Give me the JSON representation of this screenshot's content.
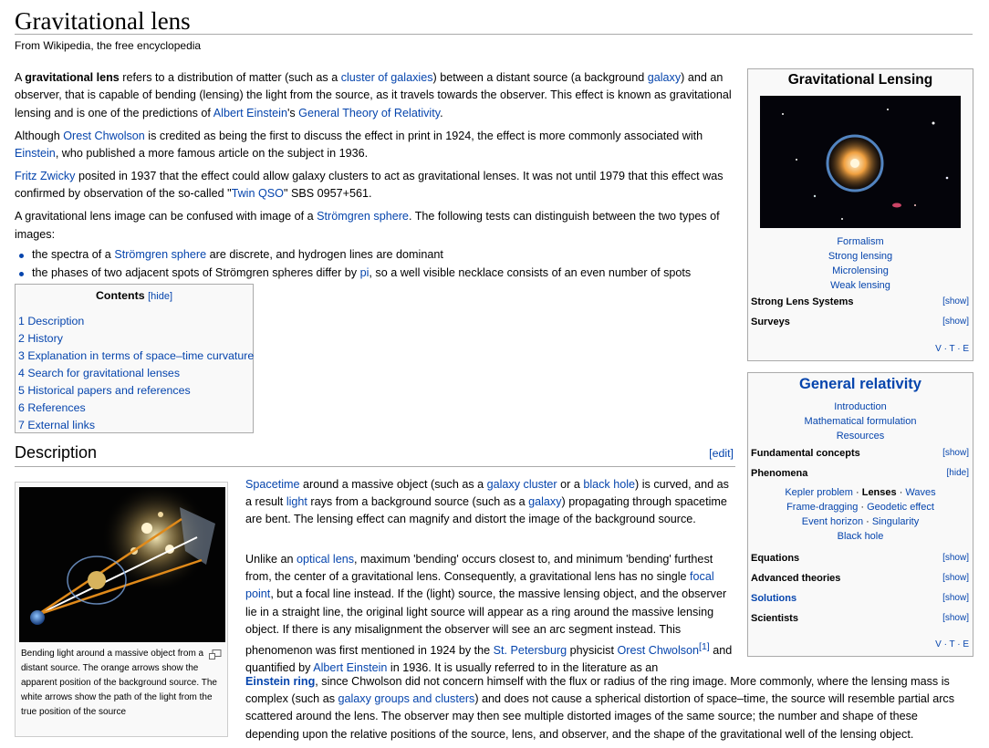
{
  "page": {
    "title": "Gravitational lens",
    "tagline": "From Wikipedia, the free encyclopedia"
  },
  "intro": {
    "p1": {
      "a": "A ",
      "bold": "gravitational lens",
      "b": " refers to a distribution of matter (such as a ",
      "link1": "cluster of galaxies",
      "c": ") between a distant source (a background ",
      "link2": "galaxy",
      "d": ") and an observer, that is capable of bending (lensing) the light from the source, as it travels towards the observer. This effect is known as gravitational lensing and is one of the predictions of ",
      "link3": "Albert Einstein",
      "e": "'s ",
      "link4": "General Theory of Relativity",
      "f": "."
    },
    "p2": {
      "a": "Although ",
      "link1": "Orest Chwolson",
      "b": " is credited as being the first to discuss the effect in print in 1924, the effect is more commonly associated with ",
      "link2": "Einstein",
      "c": ", who published a more famous article on the subject in 1936."
    },
    "p3": {
      "link1": "Fritz Zwicky",
      "a": " posited in 1937 that the effect could allow galaxy clusters to act as gravitational lenses. It was not until 1979 that this effect was confirmed by observation of the so-called \"",
      "link2": "Twin QSO",
      "b": "\" SBS 0957+561."
    },
    "p4": {
      "a": "A gravitational lens image can be confused with image of a ",
      "link1": "Strömgren sphere",
      "b": ". The following tests can distinguish between the two types of images:"
    },
    "bullets": [
      {
        "a": "the spectra of a ",
        "link": "Strömgren sphere",
        "b": " are discrete, and hydrogen lines are dominant"
      },
      {
        "a": "the phases of two adjacent spots of Strömgren spheres differ by ",
        "link": "pi",
        "b": ", so a well visible necklace consists of an even number of spots"
      }
    ]
  },
  "toc": {
    "title": "Contents",
    "hide": "[hide]",
    "items": [
      "1 Description",
      "2 History",
      "3 Explanation in terms of space–time curvature",
      "4 Search for gravitational lenses",
      "5 Historical papers and references",
      "6 References",
      "7 External links"
    ]
  },
  "description": {
    "heading": "Description",
    "edit": "[edit]",
    "thumb_caption": "Bending light around a massive object from a distant source. The orange arrows show the apparent position of the background source. The white arrows show the path of the light from the true position of the source",
    "p1": {
      "link1": "Spacetime",
      "a": " around a massive object (such as a ",
      "link2": "galaxy cluster",
      "b": " or a ",
      "link3": "black hole",
      "c": ") is curved, and as a result ",
      "link4": "light",
      "d": " rays from a background source (such as a ",
      "link5": "galaxy",
      "e": ") propagating through spacetime are bent. The lensing effect can magnify and distort the image of the background source."
    },
    "p2": {
      "a": "Unlike an ",
      "link1": "optical lens",
      "b": ", maximum 'bending' occurs closest to, and minimum 'bending' furthest from, the center of a gravitational lens. Consequently, a gravitational lens has no single ",
      "link2": "focal point",
      "c": ", but a focal line instead. If the (light) source, the massive lensing object, and the observer lie in a straight line, the original light source will appear as a ring around the massive lensing object. If there is any misalignment the observer will see an arc segment instead. This phenomenon was first mentioned in 1924 by the ",
      "link3": "St. Petersburg",
      "d": " physicist ",
      "link4": "Orest Chwolson",
      "sup": "[1]",
      "e": " and quantified by ",
      "link5": "Albert Einstein",
      "f": " in 1936. It is usually referred to in the literature as an ",
      "link6": "Einstein ring",
      "g": ", since Chwolson did not concern himself with the flux or radius of the ring image. More commonly, where the lensing mass is complex (such as ",
      "link7": "galaxy groups and clusters",
      "h": ") and does not cause a spherical distortion of space–time, the source will resemble partial arcs scattered around the lens. The observer may then see multiple distorted images of the same source; the number and shape of these depending upon the relative positions of the source, lens, and observer, and the shape of the gravitational well of the lensing object."
    }
  },
  "navbox_lensing": {
    "title": "Gravitational Lensing",
    "links": [
      "Formalism",
      "Strong lensing",
      "Microlensing",
      "Weak lensing"
    ],
    "rows": [
      {
        "label": "Strong Lens Systems",
        "toggle": "[show]"
      },
      {
        "label": "Surveys",
        "toggle": "[show]"
      }
    ],
    "vte": "V · T · E"
  },
  "navbox_gr": {
    "title": "General relativity",
    "links": [
      "Introduction",
      "Mathematical formulation",
      "Resources"
    ],
    "fundamental": {
      "label": "Fundamental concepts",
      "toggle": "[show]"
    },
    "phenomena": {
      "label": "Phenomena",
      "toggle": "[hide]",
      "line1": [
        "Kepler problem",
        "Lenses",
        "Waves"
      ],
      "line2": [
        "Frame-dragging",
        "Geodetic effect"
      ],
      "line3": [
        "Event horizon",
        "Singularity"
      ],
      "line4": [
        "Black hole"
      ]
    },
    "rows": [
      {
        "label": "Equations",
        "toggle": "[show]"
      },
      {
        "label": "Advanced theories",
        "toggle": "[show]"
      },
      {
        "label": "Solutions",
        "toggle": "[show]"
      },
      {
        "label": "Scientists",
        "toggle": "[show]"
      }
    ],
    "vte": "V · T · E"
  }
}
